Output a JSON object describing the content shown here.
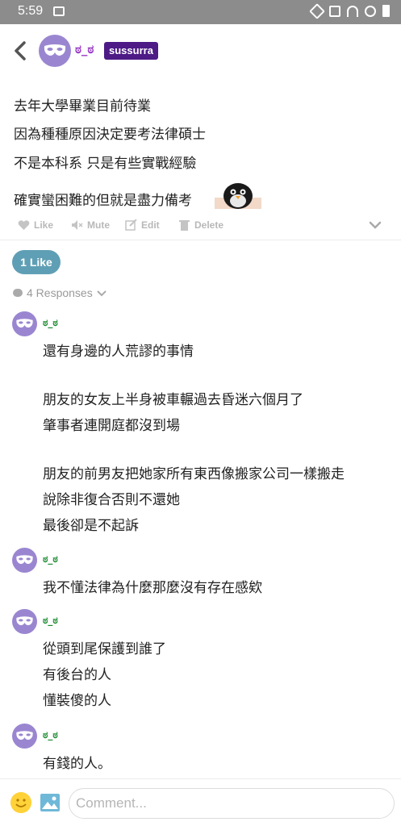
{
  "status_bar": {
    "time": "5:59"
  },
  "header": {
    "author_name": "ಠ_ಠ",
    "author_badge": "sussurra"
  },
  "post": {
    "lines": [
      "去年大學畢業目前待業",
      "因為種種原因決定要考法律碩士",
      "不是本科系 只是有些實戰經驗",
      "確實蠻困難的但就是盡力備考"
    ]
  },
  "actions": {
    "like": "Like",
    "mute": "Mute",
    "edit": "Edit",
    "delete": "Delete"
  },
  "like_pill": "1 Like",
  "responses_label": "4 Responses",
  "comments": [
    {
      "name": "ಠ_ಠ",
      "lines": [
        "還有身邊的人荒謬的事情",
        "",
        "朋友的女友上半身被車輾過去昏迷六個月了",
        "肇事者連開庭都沒到場",
        "",
        "朋友的前男友把她家所有東西像搬家公司一樣搬走",
        "說除非復合否則不還她",
        "最後卻是不起訴"
      ]
    },
    {
      "name": "ಠ_ಠ",
      "lines": [
        "我不懂法律為什麼那麼沒有存在感欸"
      ]
    },
    {
      "name": "ಠ_ಠ",
      "lines": [
        "從頭到尾保護到誰了",
        "有後台的人",
        "懂裝傻的人"
      ]
    },
    {
      "name": "ಠ_ಠ",
      "lines": [
        "有錢的人。"
      ]
    }
  ],
  "composer": {
    "placeholder": "Comment..."
  },
  "colors": {
    "badge": "#4d1a86",
    "like_pill": "#5f9fb5",
    "commenter_name": "#1a8a2e",
    "avatar": "#9a86d0"
  }
}
